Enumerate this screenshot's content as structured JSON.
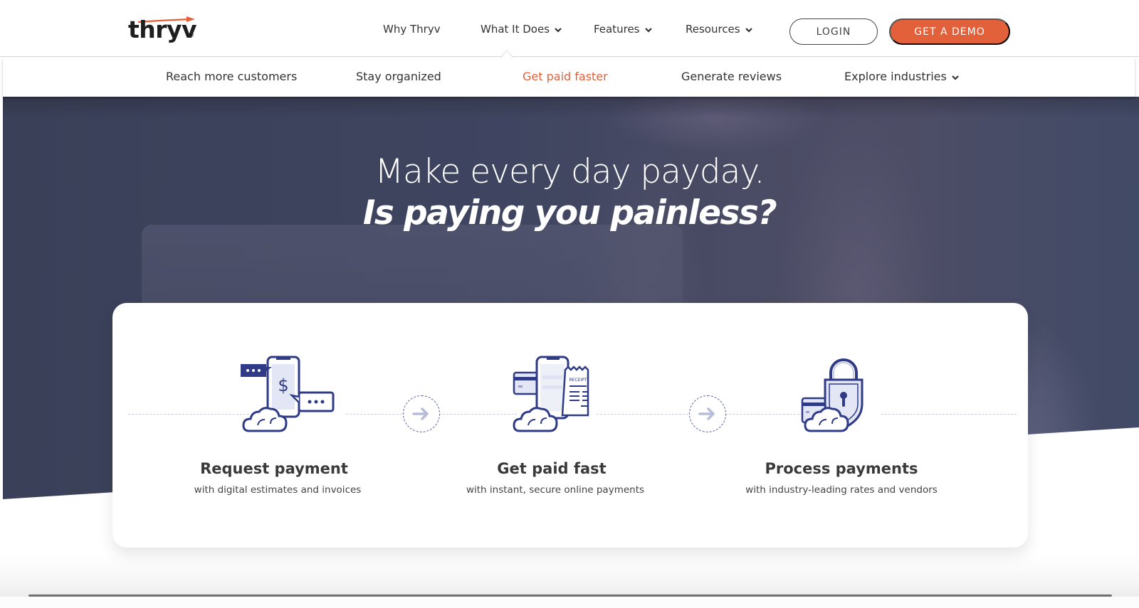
{
  "brand": {
    "logo_text": "thryv",
    "accent_color": "#e2603a",
    "ink_color": "#2f3b87"
  },
  "header": {
    "nav": [
      {
        "label": "Why Thryv",
        "has_dropdown": false
      },
      {
        "label": "What It Does",
        "has_dropdown": true,
        "active": true
      },
      {
        "label": "Features",
        "has_dropdown": true
      },
      {
        "label": "Resources",
        "has_dropdown": true
      }
    ],
    "login_label": "LOGIN",
    "demo_label": "GET A DEMO"
  },
  "subnav": {
    "items": [
      {
        "label": "Reach more customers",
        "active": false,
        "has_dropdown": false
      },
      {
        "label": "Stay organized",
        "active": false,
        "has_dropdown": false
      },
      {
        "label": "Get paid faster",
        "active": true,
        "has_dropdown": false
      },
      {
        "label": "Generate reviews",
        "active": false,
        "has_dropdown": false
      },
      {
        "label": "Explore industries",
        "active": false,
        "has_dropdown": true
      }
    ]
  },
  "hero": {
    "line1": "Make every day payday.",
    "line2": "Is paying you painless?"
  },
  "steps": [
    {
      "icon": "phone-payment-request-icon",
      "title": "Request payment",
      "description": "with digital estimates and invoices"
    },
    {
      "icon": "phone-card-receipt-icon",
      "title": "Get paid fast",
      "description": "with instant, secure online payments"
    },
    {
      "icon": "padlock-card-icon",
      "title": "Process payments",
      "description": "with industry-leading rates and vendors"
    }
  ],
  "step_connector_icon": "arrow-right-icon",
  "receipt_label": "RECEIPT"
}
